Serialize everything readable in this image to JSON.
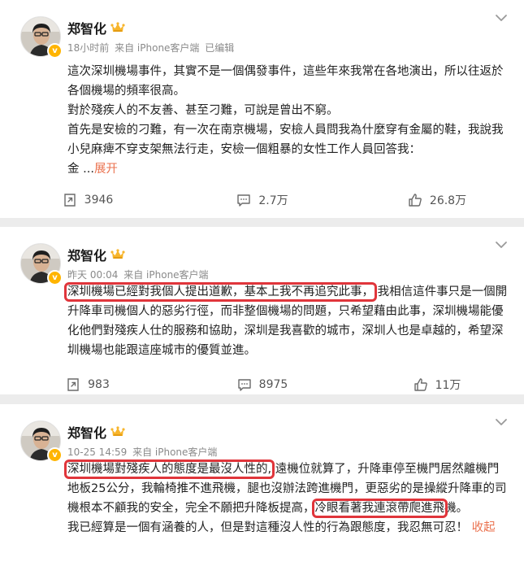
{
  "posts": [
    {
      "author": "郑智化",
      "time": "18小时前",
      "source": "来自 iPhone客户端",
      "edited": "已编辑",
      "paragraphs": [
        "這次深圳機場事件，其實不是一個偶發事件，這些年來我常在各地演出，所以往返於各個機場的頻率很高。",
        "對於殘疾人的不友善、甚至刁難，可說是曾出不窮。",
        "首先是安檢的刁難，有一次在南京機場，安檢人員問我為什麼穿有金屬的鞋，我說我小兒麻痺不穿支架無法行走，安檢一個粗暴的女性工作人員回答我：",
        "金 ..."
      ],
      "expand": "展开",
      "reposts": "3946",
      "comments": "2.7万",
      "likes": "26.8万"
    },
    {
      "author": "郑智化",
      "time": "昨天 00:04",
      "source": "来自 iPhone客户端",
      "highlight": "深圳機場已經對我個人提出道歉，基本上我不再追究此事，",
      "rest": "我相信這件事只是一個開升降車司機個人的惡劣行徑，而非整個機場的問題，只希望藉由此事，深圳機場能優化他們對殘疾人仕的服務和協助，深圳是我喜歡的城市，深圳人也是卓越的，希望深圳機場也能跟這座城市的優質並進。",
      "reposts": "983",
      "comments": "8975",
      "likes": "11万"
    },
    {
      "author": "郑智化",
      "time": "10-25 14:59",
      "source": "来自 iPhone客户端",
      "highlight1": "深圳機場對殘疾人的態度是最沒人性的,",
      "mid": "遠機位就算了，升降車停至機門居然離機門地板25公分，我輪椅推不進飛機，腿也沒辦法跨進機門，更惡劣的是操縱升降車的司機根本不顧我的安全，完全不願把升降板提高，",
      "highlight2": "冷眼看著我連滾帶爬進飛",
      "tail": "機。",
      "para2": "我已經算是一個有涵養的人，但是對這種沒人性的行為跟態度，我忍無可忍！",
      "collapse": "收起"
    }
  ],
  "icons": {
    "repost": "repost-icon",
    "comment": "comment-icon",
    "like": "like-icon",
    "more": "chevron-down-icon",
    "crown": "crown-icon",
    "verified": "verified-badge-icon"
  },
  "colors": {
    "link": "#eb7350",
    "highlight_border": "#e0353b",
    "badge": "#ffb400"
  }
}
